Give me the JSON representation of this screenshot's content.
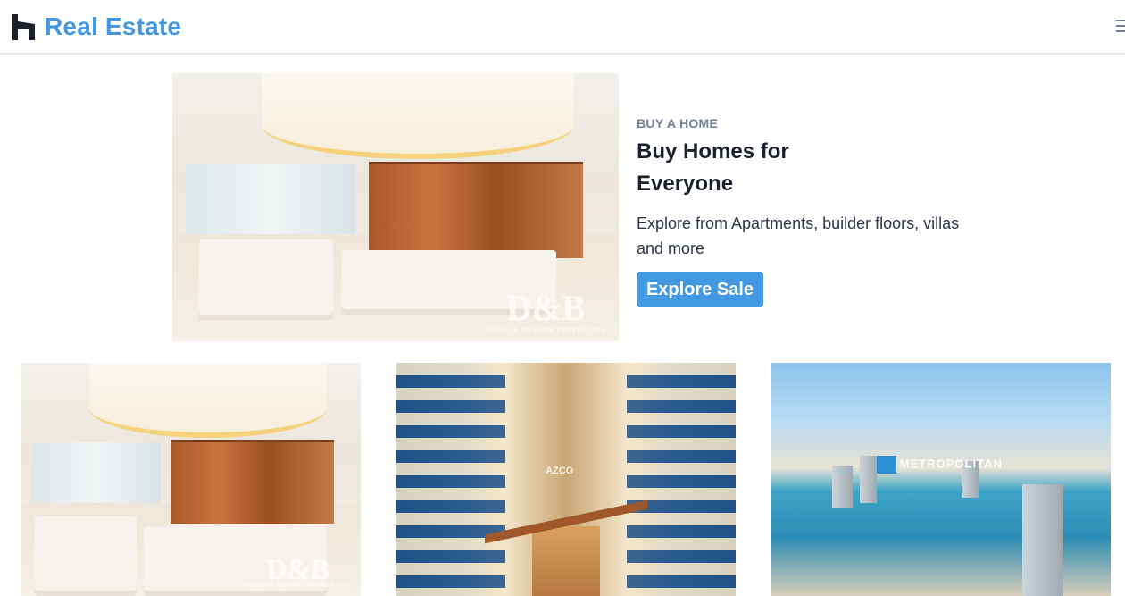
{
  "navbar": {
    "brand": "Real Estate",
    "logo_icon": "house-logo-icon",
    "menu_icon": "hamburger-menu-icon"
  },
  "hero": {
    "eyebrow": "BUY A HOME",
    "title": "Buy Homes for Everyone",
    "description": "Explore from Apartments, builder floors, villas and more",
    "cta_label": "Explore Sale",
    "image_watermark": "D&B",
    "image_watermark_sub": "DUBAI & BEYOND PROPERTIES"
  },
  "listings": [
    {
      "image": "interior-living-room",
      "watermark": "D&B",
      "watermark_sub": "DUBAI & BEYOND PROPERTIES"
    },
    {
      "image": "balcony-corridor",
      "watermark": "AZCO"
    },
    {
      "image": "marina-aerial",
      "watermark": "METROPOLITAN"
    }
  ],
  "colors": {
    "brand": "#4299e1",
    "eyebrow": "#718096",
    "heading": "#1a202c",
    "button_bg": "#4299e1"
  }
}
